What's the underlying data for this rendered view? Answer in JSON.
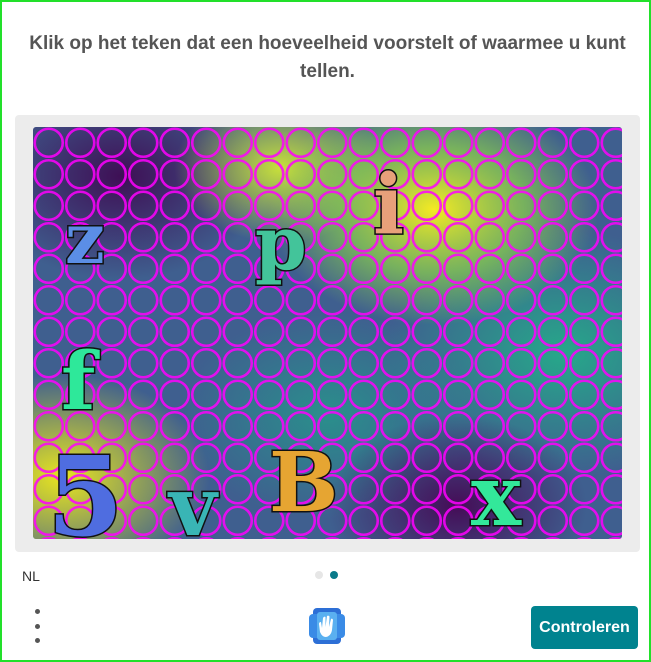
{
  "prompt": "Klik op het teken dat een hoeveelheid voorstelt of waarmee u kunt tellen.",
  "language": "NL",
  "submit_label": "Controleren",
  "pager": {
    "total": 2,
    "active": 2
  },
  "tiles": [
    {
      "char": "z",
      "color": "#5b8ee6"
    },
    {
      "char": "p",
      "color": "#43c49a"
    },
    {
      "char": "i",
      "color": "#e8a07a"
    },
    {
      "char": "f",
      "color": "#2ee89a"
    },
    {
      "char": "5",
      "color": "#4f6de0"
    },
    {
      "char": "v",
      "color": "#39b5b5"
    },
    {
      "char": "B",
      "color": "#e6a532"
    },
    {
      "char": "x",
      "color": "#33e89a"
    }
  ],
  "colors": {
    "accent": "#00838f",
    "active_dot": "#0a7a8a",
    "frame": "#22e02a",
    "circles": "#ff00ff"
  },
  "icons": {
    "logo": "hand-logo-icon",
    "menu": "vertical-dots-icon"
  }
}
